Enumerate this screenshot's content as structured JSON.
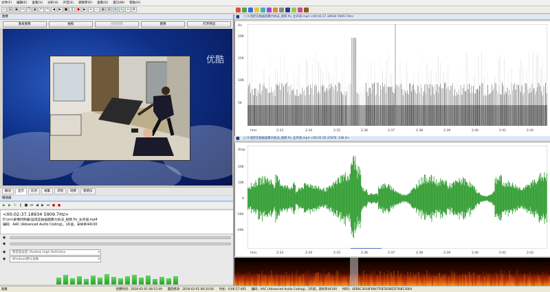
{
  "menubar": [
    "文件(F)",
    "编辑(E)",
    "查看(V)",
    "分析(A)",
    "声音(S)",
    "调频率(R)",
    "查看(O)",
    "窗口(W)",
    "帮助(H)"
  ],
  "left_panel": {
    "title": "图像",
    "buttons": [
      "激发图像",
      "拍照",
      "视频图像",
      "图像",
      "打开预览"
    ],
    "watermark": "优酷",
    "tabs": [
      "概况",
      "显示",
      "比对",
      "采集",
      "识别",
      "场景",
      "频谱仪"
    ]
  },
  "player": {
    "title": "播放器",
    "time_freq": "<00:02:37.18934 5909.7Hz>",
    "file_path": "D:\\src\\录像的制备\\监控实拍画面暴力执法_视频.flv_左声道.mp4",
    "codec": "编码：AAC (Advanced Audio Coding)，(声道，采样率44100",
    "dropdown1": "稳定度设定 (Realtek High Definition",
    "dropdown2": "Windows默认设备"
  },
  "spectrogram": {
    "title": "□ A:监控实拍画面暴力执法_视频.flv_左声道.mp4 <00:02:37.18934 5909.7Hz>",
    "y_labels": [
      "Hz",
      "20K",
      "15K",
      "10K",
      "5K"
    ],
    "x_labels": [
      "hms",
      "2:33",
      "2:34",
      "2:35",
      "2:36",
      "2:37",
      "2:38",
      "2:39",
      "2:40",
      "2:41",
      "2:42"
    ]
  },
  "waveform": {
    "title": "□ A:监控实拍画面暴力执法_视频.flv_左声道.mp4 <00:02:20.37876 -146.0>",
    "y_labels": [
      "Amp",
      "20K",
      "10K",
      "0",
      "-10K",
      "-20K"
    ],
    "x_labels": [
      "hms",
      "2:33",
      "2:34",
      "2:35",
      "2:36",
      "2:37",
      "2:38",
      "2:39",
      "2:40",
      "2:41",
      "2:42"
    ]
  },
  "statusbar": [
    "就绪",
    "创建时间：2018-02-01 08:15:49",
    "最后修改：2018-02-01 08:20:00",
    "时长：0:06:57.495",
    "编码：AAC (Advanced Audio Coding)，1声道，采样率44100",
    "MD5：4EB6C3034F6847F0E5E06E5F56813004"
  ],
  "colors": {
    "wave": "#2a9a2a",
    "title_bg": "#dfe8f4",
    "video_bg": "#0e2f86"
  }
}
